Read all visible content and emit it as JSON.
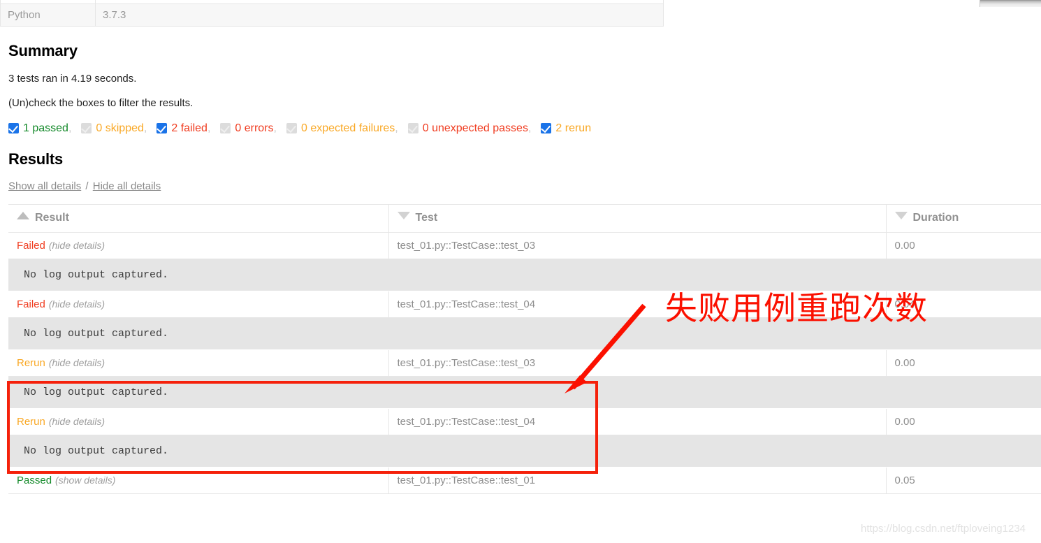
{
  "environment": {
    "rows": [
      {
        "key": "Python",
        "value": "3.7.3"
      }
    ]
  },
  "summary": {
    "heading": "Summary",
    "run_line": "3 tests ran in 4.19 seconds.",
    "filter_hint": "(Un)check the boxes to filter the results.",
    "filters": [
      {
        "label": "1 passed",
        "checked": true,
        "color_class": "c-green",
        "trailing": ","
      },
      {
        "label": "0 skipped",
        "checked": false,
        "color_class": "c-orange",
        "trailing": ","
      },
      {
        "label": "2 failed",
        "checked": true,
        "color_class": "c-red",
        "trailing": ","
      },
      {
        "label": "0 errors",
        "checked": false,
        "color_class": "c-red",
        "trailing": ","
      },
      {
        "label": "0 expected failures",
        "checked": false,
        "color_class": "c-orange",
        "trailing": ","
      },
      {
        "label": "0 unexpected passes",
        "checked": false,
        "color_class": "c-red",
        "trailing": ","
      },
      {
        "label": "2 rerun",
        "checked": true,
        "color_class": "c-orange",
        "trailing": ""
      }
    ]
  },
  "results": {
    "heading": "Results",
    "show_all": "Show all details",
    "separator": "/",
    "hide_all": "Hide all details",
    "columns": {
      "result": "Result",
      "test": "Test",
      "duration": "Duration"
    },
    "sort": {
      "result_icon": "triangle-up-icon",
      "test_icon": "triangle-down-icon",
      "duration_icon": "triangle-down-icon"
    },
    "log_text": "No log output captured.",
    "rows": [
      {
        "verdict": "Failed",
        "verdict_class": "failed",
        "toggle": "(hide details)",
        "test": "test_01.py::TestCase::test_03",
        "duration": "0.00"
      },
      {
        "verdict": "Failed",
        "verdict_class": "failed",
        "toggle": "(hide details)",
        "test": "test_01.py::TestCase::test_04",
        "duration": "0.04"
      },
      {
        "verdict": "Rerun",
        "verdict_class": "rerun",
        "toggle": "(hide details)",
        "test": "test_01.py::TestCase::test_03",
        "duration": "0.00"
      },
      {
        "verdict": "Rerun",
        "verdict_class": "rerun",
        "toggle": "(hide details)",
        "test": "test_01.py::TestCase::test_04",
        "duration": "0.00"
      },
      {
        "verdict": "Passed",
        "verdict_class": "passed",
        "toggle": "(show details)",
        "test": "test_01.py::TestCase::test_01",
        "duration": "0.05"
      }
    ]
  },
  "annotations": {
    "callout_text": "失败用例重跑次数",
    "callout_color": "#fb1000",
    "watermark": "https://blog.csdn.net/ftploveing1234"
  },
  "colors": {
    "accent_blue": "#1a73e8",
    "pass_green": "#158a2b",
    "fail_red": "#f03c20",
    "rerun_orange": "#f9a825",
    "annotation_red": "#f5210b",
    "log_bg": "#e5e5e5"
  }
}
